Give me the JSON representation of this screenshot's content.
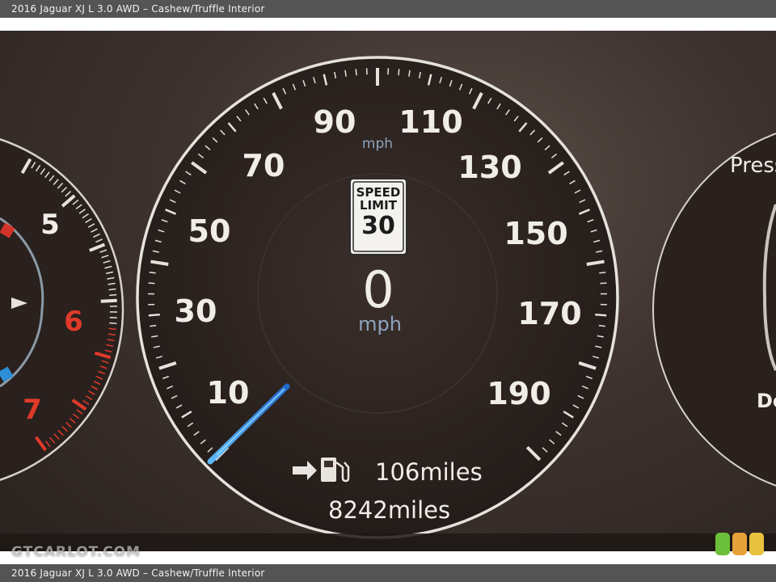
{
  "caption": {
    "top": "2016 Jaguar XJ L 3.0 AWD – Cashew/Truffle Interior",
    "bottom": "2016 Jaguar XJ L 3.0 AWD – Cashew/Truffle Interior"
  },
  "speedometer": {
    "unit_label_top": "mph",
    "speed_labels": [
      "10",
      "30",
      "50",
      "70",
      "90",
      "110",
      "130",
      "150",
      "170",
      "190"
    ],
    "speed_value": "0",
    "speed_unit": "mph",
    "speed_limit_line1": "SPEED",
    "speed_limit_line2": "LIMIT",
    "speed_limit_value": "30",
    "range_value": "106",
    "range_unit": "miles",
    "odometer_value": "8242",
    "odometer_unit": "miles"
  },
  "tachometer": {
    "labels": [
      "5",
      "6",
      "7"
    ]
  },
  "right_gauge": {
    "partial_label": "Press",
    "partial_label_bottom": "Do"
  },
  "watermark": "GTCARLOT.COM",
  "colors": {
    "needle": "#3aa8ff",
    "redline": "#e03a2a",
    "dial_bg": "#2e2420",
    "logo_green": "#6cbf3a",
    "logo_orange": "#e6a23a",
    "logo_yellow": "#e8c23e"
  },
  "icons": [
    "arrow-right-icon",
    "fuel-pump-icon"
  ]
}
